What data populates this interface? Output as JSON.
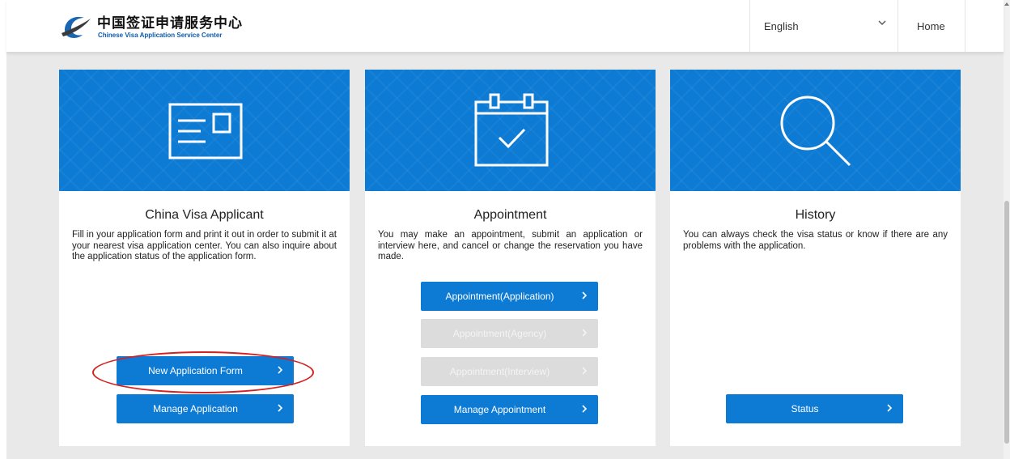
{
  "header": {
    "brand_cn": "中国签证申请服务中心",
    "brand_en": "Chinese Visa Application Service Center",
    "language": "English",
    "home": "Home"
  },
  "cards": [
    {
      "title": "China Visa Applicant",
      "icon": "application-form-icon",
      "description": "Fill in your application form and print it out in order to submit it at your nearest visa application center. You can also inquire about the application status of the application form.",
      "buttons": [
        {
          "label": "New Application Form",
          "enabled": true
        },
        {
          "label": "Manage Application",
          "enabled": true
        }
      ]
    },
    {
      "title": "Appointment",
      "icon": "calendar-check-icon",
      "description": "You may make an appointment, submit an application or interview here, and cancel or change the reservation you have made.",
      "buttons": [
        {
          "label": "Appointment(Application)",
          "enabled": true
        },
        {
          "label": "Appointment(Agency)",
          "enabled": false
        },
        {
          "label": "Appointment(Interview)",
          "enabled": false
        },
        {
          "label": "Manage Appointment",
          "enabled": true
        }
      ]
    },
    {
      "title": "History",
      "icon": "search-icon",
      "description": "You can always check the visa status or know if there are any problems with the application.",
      "buttons": [
        {
          "label": "Status",
          "enabled": true
        }
      ]
    }
  ],
  "colors": {
    "primary": "#0d7bd4",
    "disabled": "#dcdcdc",
    "highlight": "#d61f1f",
    "background": "#e9e9e9"
  }
}
